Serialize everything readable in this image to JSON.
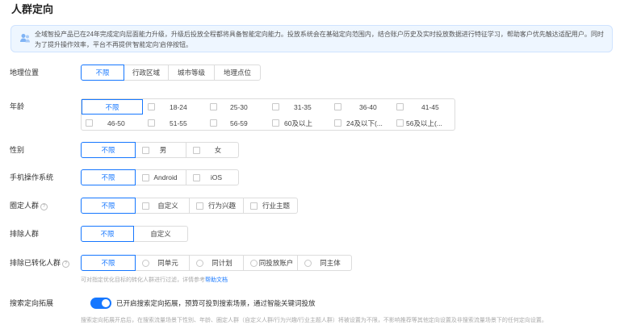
{
  "title": "人群定向",
  "notice": {
    "icon": "people-icon",
    "text": "全域智投产品已在24年完成定向层面能力升级，升级后投放全程都将具备智能定向能力。投放系统会在基础定向范围内，结合账户历史及实时投放数据进行特征学习，帮助客户优先触达适配用户。同时为了提升操作效率，平台不再提供'智能定向'启停按钮。"
  },
  "geo": {
    "label": "地理位置",
    "options": [
      "不限",
      "行政区域",
      "城市等级",
      "地理点位"
    ],
    "selected": 0
  },
  "age": {
    "label": "年龄",
    "options": [
      "不限",
      "18-24",
      "25-30",
      "31-35",
      "36-40",
      "41-45",
      "46-50",
      "51-55",
      "56-59",
      "60及以上",
      "24及以下(...",
      "56及以上(..."
    ],
    "selected": 0
  },
  "gender": {
    "label": "性别",
    "options": [
      "不限",
      "男",
      "女"
    ],
    "selected": 0
  },
  "os": {
    "label": "手机操作系统",
    "options": [
      "不限",
      "Android",
      "iOS"
    ],
    "selected": 0
  },
  "targeted_crowd": {
    "label": "圈定人群",
    "options": [
      "不限",
      "自定义",
      "行为兴趣",
      "行业主题"
    ],
    "selected": 0
  },
  "exclude_crowd": {
    "label": "排除人群",
    "options": [
      "不限",
      "自定义"
    ],
    "selected": 0
  },
  "exclude_converted": {
    "label": "排除已转化人群",
    "options": [
      "不限",
      "同单元",
      "同计划",
      "同投放账户",
      "同主体"
    ],
    "selected": 0,
    "hint": "可对指定优化目标的转化人群进行过滤，详情参考",
    "hint_link": "帮助文档"
  },
  "search_expand": {
    "label": "搜索定向拓展",
    "enabled": true,
    "text": "已开启搜索定向拓展，预算可投到搜索场景，通过智能关键词投放",
    "hint": "搜索定向拓展开启后，在搜索流量场景下性别、年龄、圈定人群（自定义人群/行为兴趣/行业主题人群）将被设置为不限，不影响推荐等其他定向设置及非搜索流量场景下的任何定向设置。"
  },
  "colors": {
    "accent": "#1677ff",
    "notice_bg": "#eef6ff",
    "border": "#dcdcdc"
  }
}
